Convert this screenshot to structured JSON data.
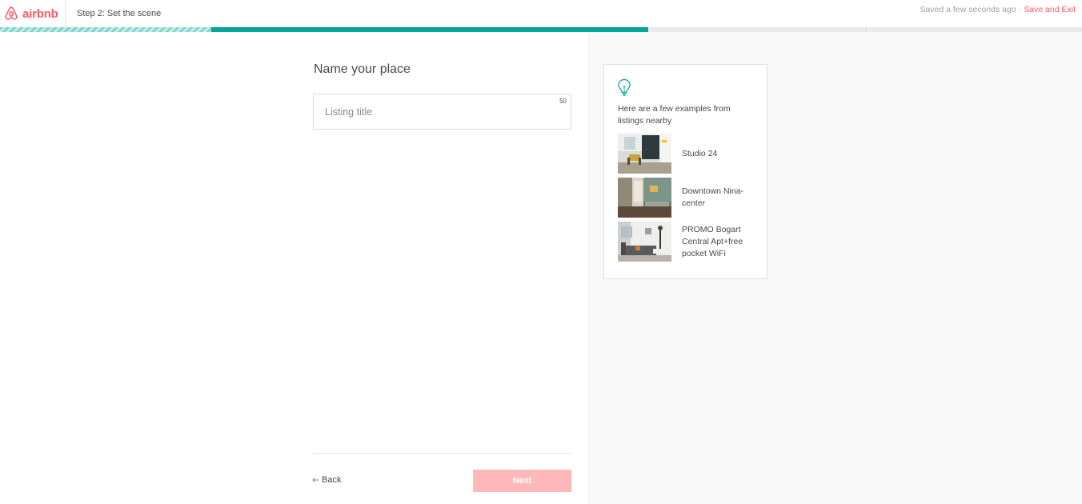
{
  "header": {
    "logo_text": "airbnb",
    "step_title": "Step 2: Set the scene",
    "saved_status": "Saved a few seconds ago",
    "separator": "·",
    "save_exit_label": "Save and Exit"
  },
  "progress": {
    "completed_fraction": 0.195,
    "current_fraction": 0.599
  },
  "form": {
    "title": "Name your place",
    "listing_title": {
      "value": "",
      "placeholder": "Listing title",
      "char_remaining": "50"
    }
  },
  "footer": {
    "back_label": "Back",
    "next_label": "Next"
  },
  "tips": {
    "icon": "lightbulb-icon",
    "intro": "Here are a few examples from listings nearby",
    "examples": [
      {
        "name": "Studio 24"
      },
      {
        "name": "Downtown Nina-center"
      },
      {
        "name": "PROMO Bogart Central Apt+free pocket WiFi"
      }
    ]
  },
  "colors": {
    "brand": "#ff5a5f",
    "progress": "#00a699",
    "next_disabled": "#ffb8ba"
  }
}
